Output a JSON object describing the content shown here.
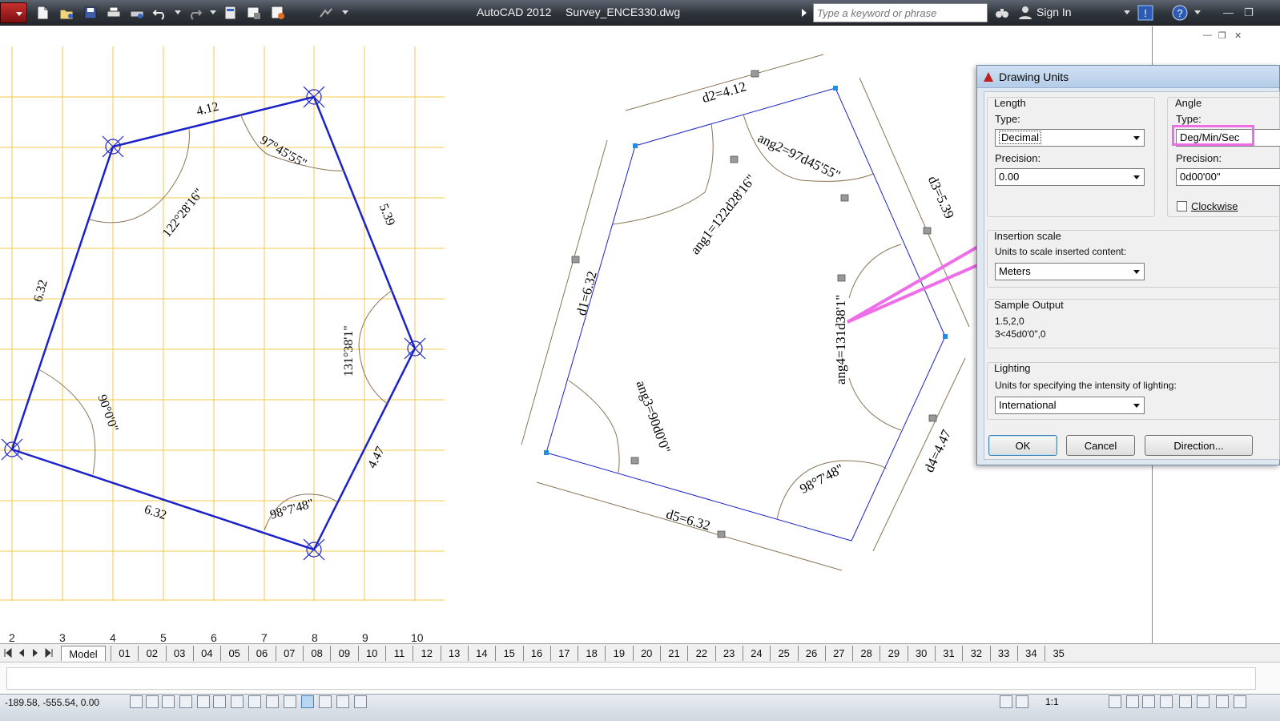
{
  "titlebar": {
    "app_name": "AutoCAD 2012",
    "file_name": "Survey_ENCE330.dwg",
    "search_placeholder": "Type a keyword or phrase",
    "sign_in": "Sign In"
  },
  "drawing": {
    "left_axis_labels": [
      "2",
      "3",
      "4",
      "5",
      "6",
      "7",
      "8",
      "9",
      "10"
    ],
    "left_labels": {
      "side_top": "4.12",
      "side_right_top": "5.39",
      "side_left": "6.32",
      "side_right_bottom": "4.47",
      "side_bottom": "6.32",
      "angle_a": "122°28'16\"",
      "angle_b": "97°45'55\"",
      "angle_c": "131°38'1\"",
      "angle_d": "90°0'0\"",
      "angle_e": "98°7'48\""
    },
    "right_labels": {
      "d1": "d1=6.32",
      "d2": "d2=4.12",
      "d3": "d3=5.39",
      "d4": "d4=4.47",
      "d5": "d5=6.32",
      "ang1": "ang1=122d28'16\"",
      "ang2": "ang2=97d45'55\"",
      "ang3": "ang3=90d0'0\"",
      "ang4": "ang4=131d38'1\"",
      "ang5": "98°7'48\""
    }
  },
  "dialog": {
    "title": "Drawing Units",
    "length": {
      "group": "Length",
      "type_label": "Type:",
      "type_value": "Decimal",
      "precision_label": "Precision:",
      "precision_value": "0.00"
    },
    "angle": {
      "group": "Angle",
      "type_label": "Type:",
      "type_value": "Deg/Min/Sec",
      "precision_label": "Precision:",
      "precision_value": "0d00'00\"",
      "clockwise_label": "Clockwise",
      "clockwise_checked": false
    },
    "insertion": {
      "group": "Insertion scale",
      "label": "Units to scale inserted content:",
      "value": "Meters"
    },
    "sample": {
      "group": "Sample Output",
      "line1": "1.5,2,0",
      "line2": "3<45d0'0\",0"
    },
    "lighting": {
      "group": "Lighting",
      "label": "Units for specifying the intensity of lighting:",
      "value": "International"
    },
    "buttons": {
      "ok": "OK",
      "cancel": "Cancel",
      "direction": "Direction..."
    }
  },
  "tabs": {
    "model": "Model",
    "layouts": [
      "01",
      "02",
      "03",
      "04",
      "05",
      "06",
      "07",
      "08",
      "09",
      "10",
      "11",
      "12",
      "13",
      "14",
      "15",
      "16",
      "17",
      "18",
      "19",
      "20",
      "21",
      "22",
      "23",
      "24",
      "25",
      "26",
      "27",
      "28",
      "29",
      "30",
      "31",
      "32",
      "33",
      "34",
      "35"
    ]
  },
  "statusbar": {
    "coords": "-189.58, -555.54, 0.00",
    "scale": "1:1"
  },
  "colors": {
    "grid": "#f2c84b",
    "polygon": "#1b22c8",
    "dimension": "#8b7355",
    "highlight": "#ee6ee8"
  }
}
